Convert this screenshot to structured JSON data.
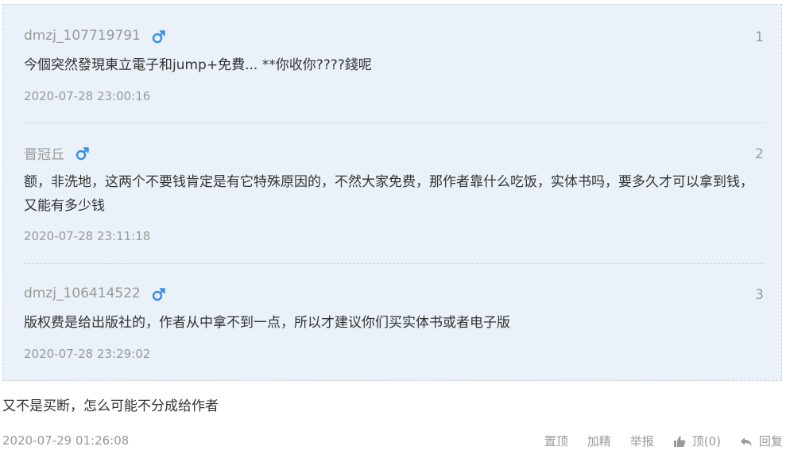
{
  "quoted_comments": [
    {
      "username": "dmzj_107719791",
      "gender_icon": "male-icon",
      "floor": "1",
      "text": "今個突然發現東立電子和jump+免費... **你收你????錢呢",
      "time": "2020-07-28 23:00:16"
    },
    {
      "username": "晋冠丘",
      "gender_icon": "male-icon",
      "floor": "2",
      "text": "额，非洗地，这两个不要钱肯定是有它特殊原因的，不然大家免费，那作者靠什么吃饭，实体书吗，要多久才可以拿到钱，又能有多少钱",
      "time": "2020-07-28 23:11:18"
    },
    {
      "username": "dmzj_106414522",
      "gender_icon": "male-icon",
      "floor": "3",
      "text": "版权费是给出版社的，作者从中拿不到一点，所以才建议你们买实体书或者电子版",
      "time": "2020-07-28 23:29:02"
    }
  ],
  "main_comment": {
    "text": "又不是买断，怎么可能不分成给作者",
    "time": "2020-07-29 01:26:08"
  },
  "actions": {
    "pin": "置顶",
    "feature": "加精",
    "report": "举报",
    "like": "顶(0)",
    "reply": "回复"
  },
  "colors": {
    "quote_bg": "#eaf1f8",
    "male_icon": "#3a8ee6",
    "muted_text": "#999999",
    "body_text": "#333333"
  }
}
